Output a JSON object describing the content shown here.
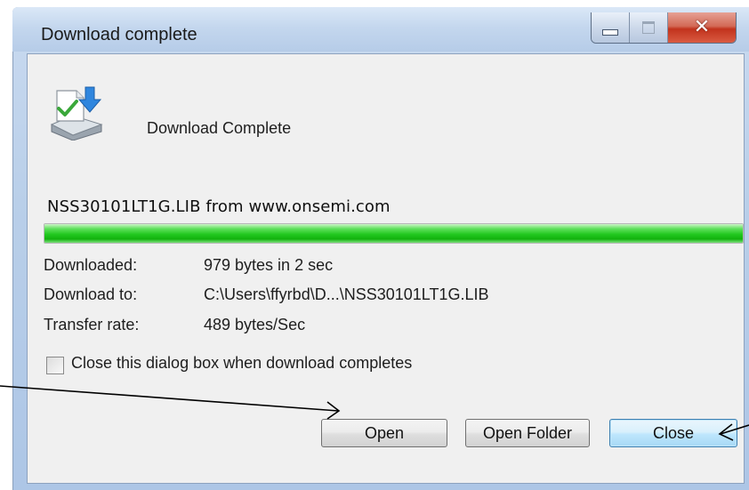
{
  "window": {
    "title": "Download complete",
    "caption_buttons": [
      "minimize",
      "maximize",
      "close"
    ]
  },
  "header": {
    "icon": "download-complete-icon",
    "headline": "Download Complete"
  },
  "download": {
    "source": "NSS30101LT1G.LIB from www.onsemi.com",
    "progress_percent": 100,
    "progress_color": "#22c81f"
  },
  "details": {
    "downloaded_label": "Downloaded:",
    "downloaded_value": "979 bytes in 2 sec",
    "download_to_label": "Download to:",
    "download_to_value": "C:\\Users\\ffyrbd\\D...\\NSS30101LT1G.LIB",
    "transfer_rate_label": "Transfer rate:",
    "transfer_rate_value": "489 bytes/Sec"
  },
  "options": {
    "close_when_complete_label": "Close this dialog box when download completes",
    "close_when_complete_checked": false
  },
  "buttons": {
    "open": "Open",
    "open_folder": "Open Folder",
    "close": "Close"
  },
  "annotations": {
    "arrow_color": "#000000",
    "targets": [
      "open-button",
      "close-button"
    ]
  }
}
